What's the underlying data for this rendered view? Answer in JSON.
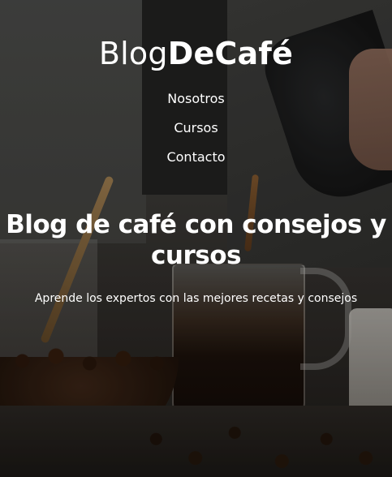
{
  "header": {
    "logo_regular": "Blog",
    "logo_bold": "DeCafé",
    "nav": [
      {
        "label": "Nosotros"
      },
      {
        "label": "Cursos"
      },
      {
        "label": "Contacto"
      }
    ]
  },
  "hero": {
    "title": "Blog de café con consejos y cursos",
    "subtitle": "Aprende los expertos con las mejores recetas y consejos"
  }
}
